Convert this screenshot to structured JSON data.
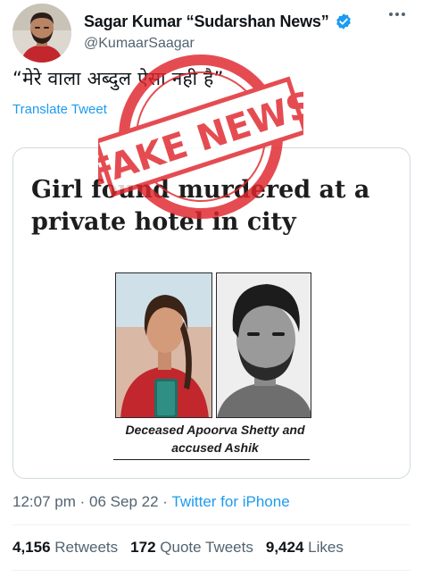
{
  "author": {
    "display_name": "Sagar Kumar “Sudarshan News”",
    "handle": "@KumaarSaagar",
    "verified": true
  },
  "tweet": {
    "text": "“मेरे वाला अब्दुल ऐसा नही है”",
    "translate_label": "Translate Tweet"
  },
  "overlay": {
    "stamp_text": "FAKE NEWS",
    "stamp_color": "#e0262d"
  },
  "card": {
    "headline": "Girl found murdered at a private hotel in city",
    "caption_line1": "Deceased Apoorva Shetty and",
    "caption_line2": "accused Ashik"
  },
  "meta": {
    "time": "12:07 pm",
    "separator": "·",
    "date": "06 Sep 22",
    "source": "Twitter for iPhone"
  },
  "stats": {
    "retweets_count": "4,156",
    "retweets_label": "Retweets",
    "quotes_count": "172",
    "quotes_label": "Quote Tweets",
    "likes_count": "9,424",
    "likes_label": "Likes"
  },
  "colors": {
    "accent": "#1d9bf0",
    "secondary_text": "#536471",
    "border": "#cfd9de"
  },
  "icons": [
    "verified-badge-icon",
    "more-options-icon"
  ]
}
